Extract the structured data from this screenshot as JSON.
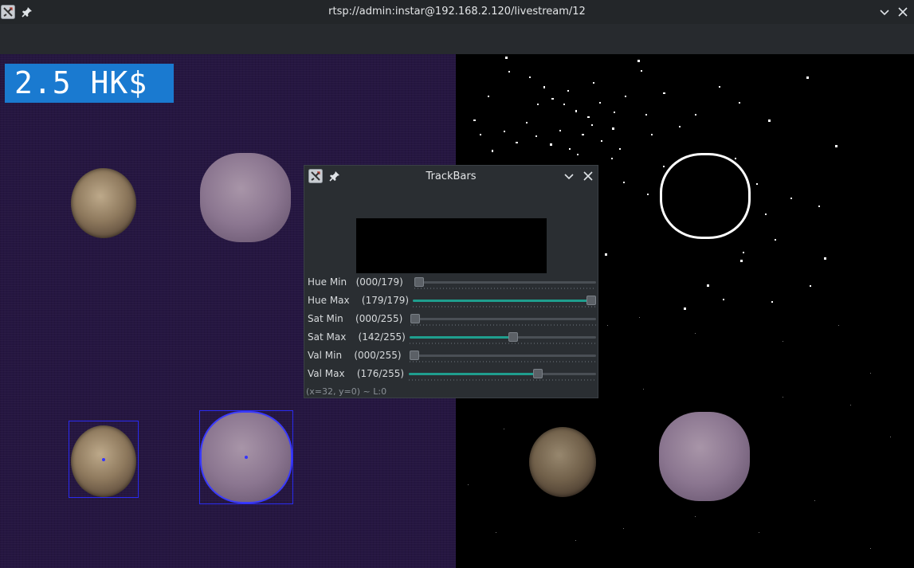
{
  "window": {
    "title": "rtsp://admin:instar@192.168.2.120/livestream/12",
    "app_icon": "x-app-icon",
    "pin_icon": "pin-icon",
    "minimize_icon": "chevron-down-icon",
    "close_icon": "close-icon"
  },
  "overlay": {
    "amount_text": "2.5 HK$",
    "badge_color": "#1a7ad0"
  },
  "trackbars": {
    "title": "TrackBars",
    "status": "(x=32, y=0) ~ L:0",
    "accent": "#1f9e8e",
    "sliders": [
      {
        "label": "Hue Min   (000/179)",
        "value": 0,
        "max": 179
      },
      {
        "label": "Hue Max    (179/179)",
        "value": 179,
        "max": 179
      },
      {
        "label": "Sat Min    (000/255)",
        "value": 0,
        "max": 255
      },
      {
        "label": "Sat Max    (142/255)",
        "value": 142,
        "max": 255
      },
      {
        "label": "Val Min    (000/255)",
        "value": 0,
        "max": 255
      },
      {
        "label": "Val Max    (176/255)",
        "value": 176,
        "max": 255
      }
    ]
  }
}
